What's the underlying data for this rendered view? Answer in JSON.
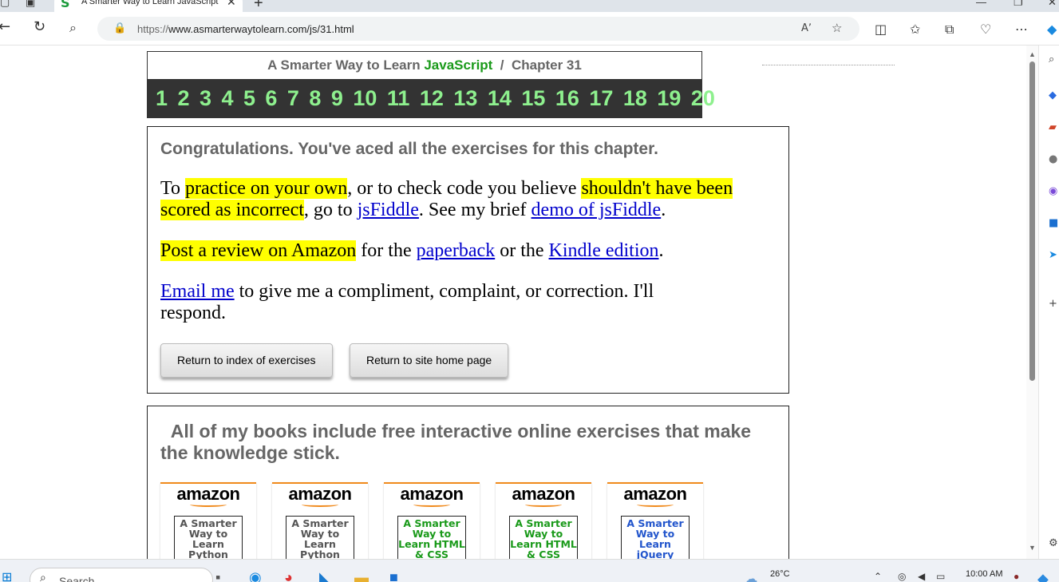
{
  "browser": {
    "tab_favicon": "S",
    "tab_title": "A Smarter Way to Learn JavaScript",
    "tab_close": "✕",
    "new_tab": "+",
    "url_prefix": "https://",
    "url_main": "www.asmarterwaytolearn.com/js/31.html",
    "icons": [
      "back-icon",
      "refresh-icon",
      "search-icon",
      "lock-icon",
      "read-aloud-icon",
      "favorite-star-icon",
      "split-screen-icon",
      "favorites-icon",
      "collections-icon",
      "browser-essentials-icon",
      "more-icon",
      "copilot-icon"
    ]
  },
  "header": {
    "title_prefix": "A Smarter Way to Learn ",
    "title_js": "JavaScript",
    "title_sep": "  /  ",
    "title_chapter": "Chapter 31",
    "chapters": [
      "1",
      "2",
      "3",
      "4",
      "5",
      "6",
      "7",
      "8",
      "9",
      "10",
      "11",
      "12",
      "13",
      "14",
      "15",
      "16",
      "17",
      "18",
      "19",
      "20"
    ]
  },
  "congrats": {
    "heading": "Congratulations. You've aced all the exercises for this chapter.",
    "p1_a": "To ",
    "p1_hl1": "practice on your own",
    "p1_b": ", or to check code you believe ",
    "p1_hl2": "shouldn't have been scored as incorrect",
    "p1_c": ", go to ",
    "p1_link1": "jsFiddle",
    "p1_d": ". See my brief ",
    "p1_link2": "demo of jsFiddle",
    "p1_e": ".",
    "p2_hl": "Post a review on Amazon",
    "p2_a": " for the ",
    "p2_link1": "paperback",
    "p2_b": " or the ",
    "p2_link2": "Kindle edition",
    "p2_c": ".",
    "p3_link": "Email me",
    "p3_a": " to give me a compliment, complaint, or correction. I'll respond.",
    "btn_index": "Return to index of exercises",
    "btn_home": "Return to site home page"
  },
  "books": {
    "heading": "All of my books include free interactive online exercises that make the knowledge stick.",
    "items": [
      {
        "brand": "amazon",
        "cover": "A Smarter Way to Learn Python",
        "color": "#555555"
      },
      {
        "brand": "amazon",
        "cover": "A Smarter Way to Learn Python",
        "color": "#555555"
      },
      {
        "brand": "amazon",
        "cover": "A Smarter Way to Learn HTML & CSS",
        "color": "#1a9a1a"
      },
      {
        "brand": "amazon",
        "cover": "A Smarter Way to Learn HTML & CSS",
        "color": "#1a9a1a"
      },
      {
        "brand": "amazon",
        "cover": "A Smarter Way to Learn jQuery",
        "color": "#2255cc"
      }
    ]
  },
  "taskbar": {
    "search_placeholder": "Search",
    "temperature": "26°C",
    "time": "10:00 AM"
  }
}
